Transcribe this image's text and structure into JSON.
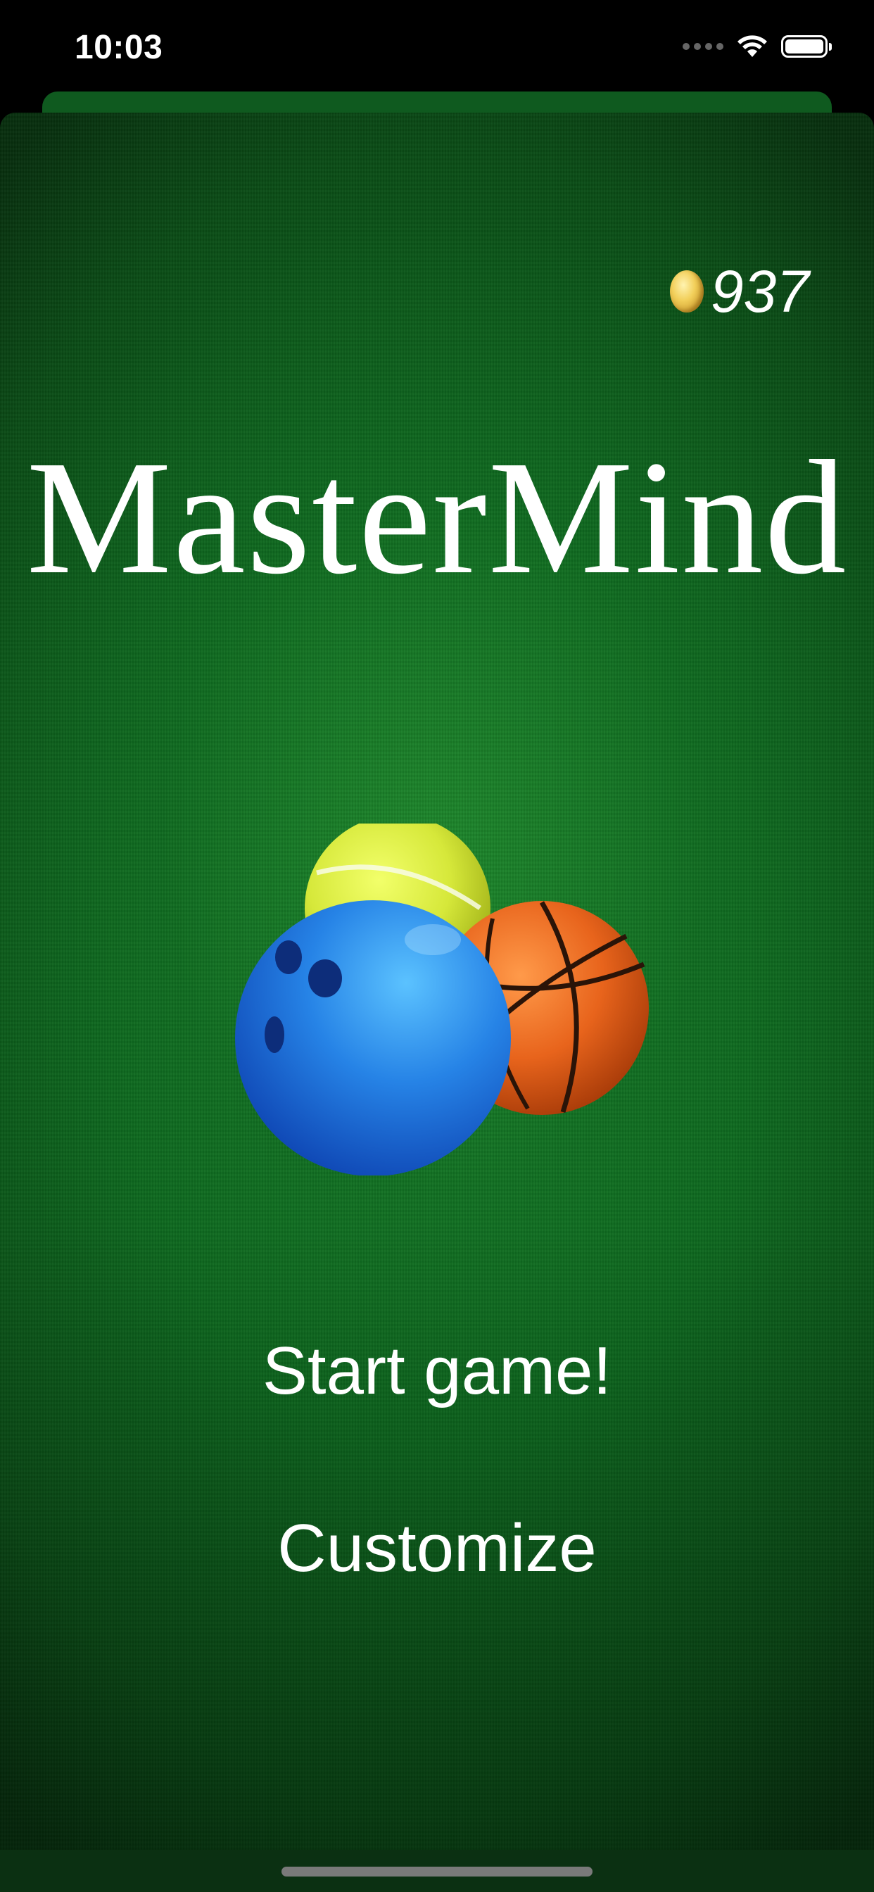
{
  "status_bar": {
    "time": "10:03"
  },
  "header": {
    "coins": "937",
    "coin_icon": "gold-coin-icon"
  },
  "title": "MasterMind",
  "hero": {
    "icons": [
      "tennis-ball-icon",
      "bowling-ball-icon",
      "basketball-icon"
    ]
  },
  "menu": {
    "start_label": "Start game!",
    "customize_label": "Customize"
  },
  "colors": {
    "felt": "#0d6a1f",
    "text": "#ffffff",
    "coin": "#f2cf5a"
  }
}
